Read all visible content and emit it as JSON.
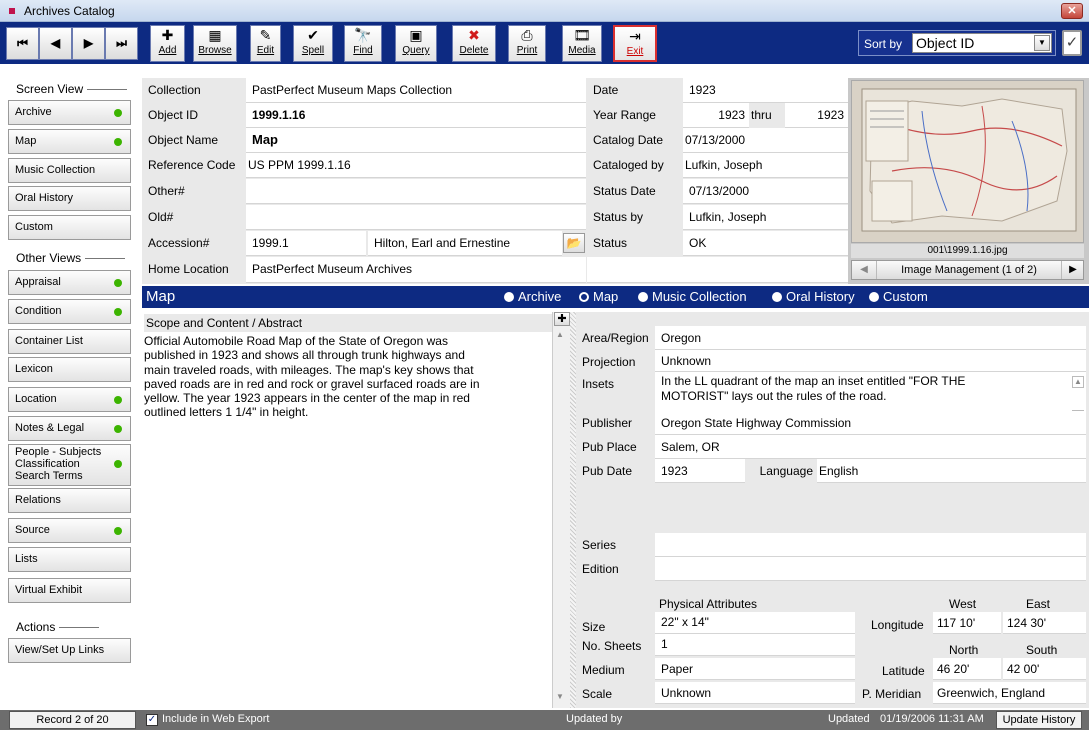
{
  "window": {
    "title": "Archives Catalog"
  },
  "toolbar": {
    "nav": [
      "⏮",
      "◀",
      "▶",
      "⏭"
    ],
    "buttons": [
      {
        "label": "Add",
        "icon": "✚"
      },
      {
        "label": "Browse",
        "icon": "▦"
      },
      {
        "label": "Edit",
        "icon": "✎"
      },
      {
        "label": "Spell",
        "icon": "✔"
      },
      {
        "label": "Find",
        "icon": "🔭"
      },
      {
        "label": "Query",
        "icon": "▣"
      },
      {
        "label": "Delete",
        "icon": "✖"
      },
      {
        "label": "Print",
        "icon": "⎙"
      },
      {
        "label": "Media",
        "icon": "🎞"
      },
      {
        "label": "Exit",
        "icon": "⇥"
      }
    ],
    "sort_label": "Sort by",
    "sort_value": "Object ID"
  },
  "sidebar": {
    "screen_view_title": "Screen View",
    "screen_views": [
      "Archive",
      "Map",
      "Music Collection",
      "Oral History",
      "Custom"
    ],
    "other_views_title": "Other Views",
    "other_views": [
      "Appraisal",
      "Condition",
      "Container List",
      "Lexicon",
      "Location",
      "Notes & Legal",
      "People - Subjects Classification Search Terms",
      "Relations",
      "Source",
      "Lists",
      "Virtual Exhibit"
    ],
    "people_lines": [
      "People - Subjects",
      "Classification",
      "Search Terms"
    ],
    "actions_title": "Actions",
    "actions": [
      "View/Set Up Links"
    ]
  },
  "record": {
    "labels": {
      "collection": "Collection",
      "object_id": "Object ID",
      "object_name": "Object Name",
      "reference_code": "Reference Code",
      "other_num": "Other#",
      "old_num": "Old#",
      "accession": "Accession#",
      "home_location": "Home Location",
      "date": "Date",
      "year_range": "Year Range",
      "thru": "thru",
      "catalog_date": "Catalog Date",
      "cataloged_by": "Cataloged by",
      "status_date": "Status Date",
      "status_by": "Status by",
      "status": "Status"
    },
    "collection": "PastPerfect Museum Maps Collection",
    "object_id": "1999.1.16",
    "object_name": "Map",
    "reference_code": "US PPM 1999.1.16",
    "other_num": "",
    "old_num": "",
    "accession": "1999.1",
    "accession_donor": "Hilton, Earl and Ernestine",
    "home_location": "PastPerfect Museum Archives",
    "date": "1923",
    "year_from": "1923",
    "year_to": "1923",
    "catalog_date": "07/13/2000",
    "cataloged_by": "Lufkin, Joseph",
    "status_date": "07/13/2000",
    "status_by": "Lufkin, Joseph",
    "status": "OK"
  },
  "image": {
    "filename": "001\\1999.1.16.jpg",
    "management": "Image Management (1 of 2)"
  },
  "map_section": {
    "title": "Map",
    "radios": [
      "Archive",
      "Map",
      "Music Collection",
      "Oral History",
      "Custom"
    ],
    "selected": "Map",
    "scope_label": "Scope and Content / Abstract",
    "scope_lines": [
      "Official Automobile Road Map of the State of Oregon was",
      "published in 1923 and shows all through trunk highways and",
      "main traveled roads, with mileages.  The map's key shows that",
      "paved roads are in red and rock or gravel surfaced roads are in",
      "yellow.  The year 1923 appears in the center of the map in red",
      "outlined letters 1 1/4\" in height."
    ],
    "labels": {
      "area_region": "Area/Region",
      "projection": "Projection",
      "insets": "Insets",
      "publisher": "Publisher",
      "pub_place": "Pub Place",
      "pub_date": "Pub Date",
      "language": "Language",
      "series": "Series",
      "edition": "Edition",
      "physical_attributes": "Physical Attributes",
      "size": "Size",
      "no_sheets": "No. Sheets",
      "medium": "Medium",
      "scale": "Scale",
      "west": "West",
      "east": "East",
      "north": "North",
      "south": "South",
      "longitude": "Longitude",
      "latitude": "Latitude",
      "p_meridian": "P. Meridian"
    },
    "area_region": "Oregon",
    "projection": "Unknown",
    "insets_lines": [
      "In the LL quadrant of the map an inset entitled \"FOR THE",
      "MOTORIST\" lays out the rules of the road."
    ],
    "publisher": "Oregon State Highway Commission",
    "pub_place": "Salem, OR",
    "pub_date": "1923",
    "language": "English",
    "series": "",
    "edition": "",
    "size": "22\" x 14\"",
    "no_sheets": "1",
    "medium": "Paper",
    "scale": "Unknown",
    "longitude_west": "117 10'",
    "longitude_east": "124 30'",
    "latitude_north": "46 20'",
    "latitude_south": "42 00'",
    "p_meridian": "Greenwich, England"
  },
  "status_bar": {
    "record": "Record 2 of 20",
    "include_web": "Include in Web Export",
    "updated_by_label": "Updated by",
    "updated_by": "",
    "updated_label": "Updated",
    "updated": "01/19/2006 11:31 AM",
    "history_button": "Update History"
  }
}
